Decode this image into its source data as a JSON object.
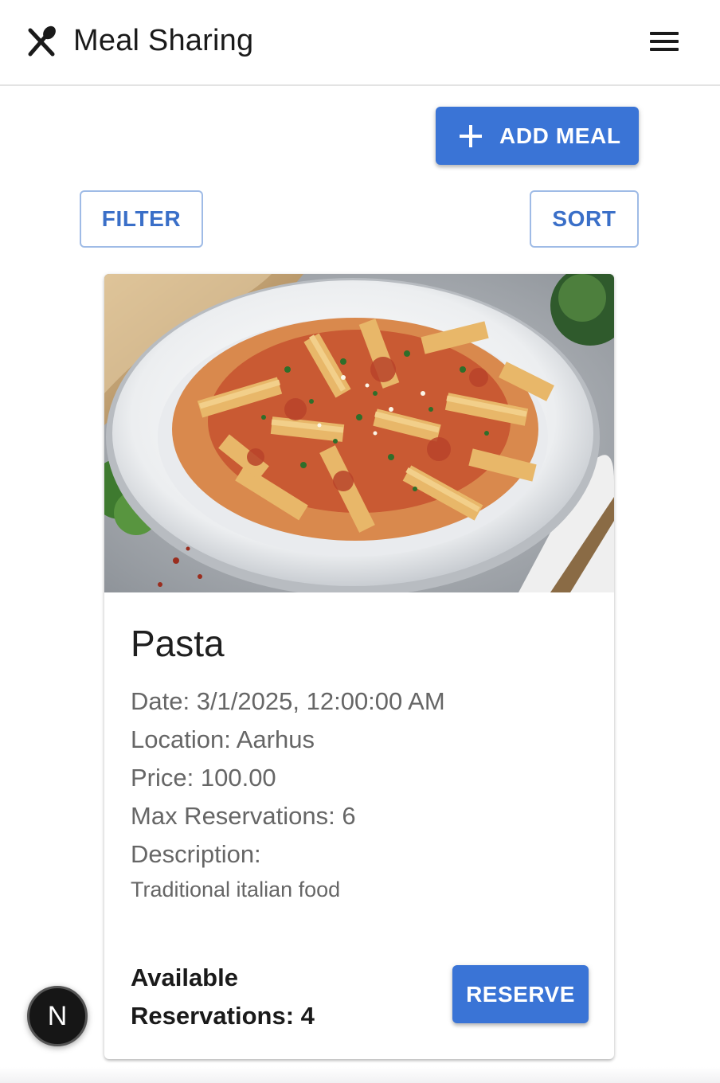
{
  "appbar": {
    "title": "Meal Sharing",
    "logo_icon": "fork-spoon-crossed-icon",
    "menu_icon": "hamburger-menu-icon"
  },
  "toolbar": {
    "add_label": "ADD MEAL",
    "add_icon": "plus-icon",
    "filter_label": "FILTER",
    "sort_label": "SORT"
  },
  "colors": {
    "primary": "#3a74d6",
    "outline": "#9fbbe6",
    "secondary_text": "#666666"
  },
  "meal": {
    "image": "penne pasta in tomato sauce with parsley and parmesan",
    "title": "Pasta",
    "date": "Date: 3/1/2025, 12:00:00 AM",
    "location": "Location: Aarhus",
    "price": "Price: 100.00",
    "max_reservations": "Max Reservations: 6",
    "description_label": "Description:",
    "description": "Traditional italian food",
    "available": "Available Reservations: 4",
    "reserve_label": "RESERVE"
  },
  "dev_badge": {
    "letter": "N",
    "icon": "nextjs-logo-icon"
  }
}
